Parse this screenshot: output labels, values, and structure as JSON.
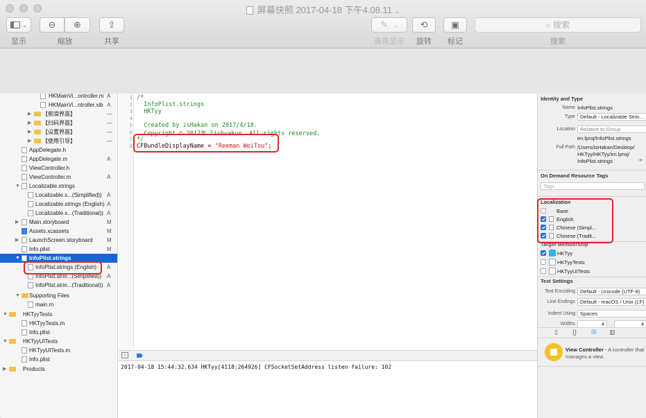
{
  "window": {
    "title": "屏幕快照 2017-04-18 下午4.08.11"
  },
  "toolbar": {
    "display_label": "显示",
    "zoom_label": "缩放",
    "share_label": "共享",
    "highlight_label": "高亮显示",
    "rotate_label": "旋转",
    "mark_label": "标记",
    "search_placeholder": "搜索",
    "search_label": "搜索"
  },
  "navigator": {
    "items": [
      {
        "name": "HKMainVi...ontroller.m",
        "badge": "A"
      },
      {
        "name": "HKMainVi...ntroller.xib",
        "badge": "A"
      },
      {
        "name": "【侧滑界面】",
        "badge": "—"
      },
      {
        "name": "【扫码界面】",
        "badge": "—"
      },
      {
        "name": "【设置界面】",
        "badge": "—"
      },
      {
        "name": "【使用引导】",
        "badge": "—"
      },
      {
        "name": "AppDelegate.h",
        "badge": ""
      },
      {
        "name": "AppDelegate.m",
        "badge": "A"
      },
      {
        "name": "ViewController.h",
        "badge": ""
      },
      {
        "name": "ViewController.m",
        "badge": "A"
      },
      {
        "name": "Localizable.strings",
        "badge": ""
      },
      {
        "name": "Localizable.s...(Simplified))",
        "badge": "A"
      },
      {
        "name": "Localizable.strings (English)",
        "badge": "A"
      },
      {
        "name": "Localizable.s...(Traditional))",
        "badge": "A"
      },
      {
        "name": "Main.storyboard",
        "badge": "M"
      },
      {
        "name": "Assets.xcassets",
        "badge": "M"
      },
      {
        "name": "LaunchScreen.storyboard",
        "badge": "M"
      },
      {
        "name": "Info.plist",
        "badge": "M"
      },
      {
        "name": "InfoPlist.strings",
        "badge": ""
      },
      {
        "name": "InfoPlist.strings (English)",
        "badge": "A"
      },
      {
        "name": "InfoPlist.strin...(Simplified))",
        "badge": "A"
      },
      {
        "name": "InfoPlist.strin...(Traditional))",
        "badge": "A"
      },
      {
        "name": "Supporting Files",
        "badge": ""
      },
      {
        "name": "main.m",
        "badge": ""
      },
      {
        "name": "HKTyyTests",
        "badge": ""
      },
      {
        "name": "HKTyyTests.m",
        "badge": ""
      },
      {
        "name": "Info.plist",
        "badge": ""
      },
      {
        "name": "HKTyyUITests",
        "badge": ""
      },
      {
        "name": "HKTyyUITests.m",
        "badge": ""
      },
      {
        "name": "Info.plist",
        "badge": ""
      },
      {
        "name": "Products",
        "badge": ""
      }
    ]
  },
  "editor": {
    "lines": [
      {
        "n": "1",
        "text": "/*"
      },
      {
        "n": "2",
        "text": "  InfoPlist.strings"
      },
      {
        "n": "3",
        "text": "  HKTyy"
      },
      {
        "n": "4",
        "text": ""
      },
      {
        "n": "5",
        "text": "  Created by isHakan on 2017/4/18."
      },
      {
        "n": "6",
        "text": "  Copyright © 2017年 liuhuakun. All rights reserved."
      },
      {
        "n": "7",
        "text": "*/"
      }
    ],
    "line8_num": "8",
    "line8_key": "CFBundleDisplayName = ",
    "line8_value": "\"Reeman WeiTou\"",
    "line8_end": ";"
  },
  "console": {
    "line1": "2017-04-18 15:44:32.634 HKTyy[4118:264926] CFSocketSetAddress listen failure: 102"
  },
  "inspector": {
    "identity_header": "Identity and Type",
    "name_label": "Name",
    "name_value": "InfoPlist.strings",
    "type_label": "Type",
    "type_value": "Default - Localizable Strin...",
    "location_label": "Location",
    "location_value": "Relative to Group",
    "location_path": "en.lproj/InfoPlist.strings",
    "fullpath_label": "Full Path",
    "fullpath_1": "/Users/isHakan/Desktop/",
    "fullpath_2": "HKTyy/HKTyy/en.lproj/",
    "fullpath_3": "InfoPlist.strings",
    "odr_header": "On Demand Resource Tags",
    "tags_placeholder": "Tags",
    "localization_header": "Localization",
    "loc_base": "Base",
    "loc_english": "English",
    "loc_simpl": "Chinese (Simpl...",
    "loc_trad": "Chinese (Tradit...",
    "target_header": "Target Membership",
    "target_1": "HKTyy",
    "target_2": "HKTyyTests",
    "target_3": "HKTyyUITests",
    "text_header": "Text Settings",
    "encoding_label": "Text Encoding",
    "encoding_value": "Default - Unicode (UTF-8)",
    "endings_label": "Line Endings",
    "endings_value": "Default - macOS / Unix (LF)",
    "indent_label": "Indent Using",
    "indent_value": "Spaces",
    "widths_label": "Widths",
    "widths_tab": "4",
    "widths_indent": "4",
    "vc_title": "View Controller",
    "vc_desc_1": " - A controller that",
    "vc_desc_2": "manages a view."
  }
}
